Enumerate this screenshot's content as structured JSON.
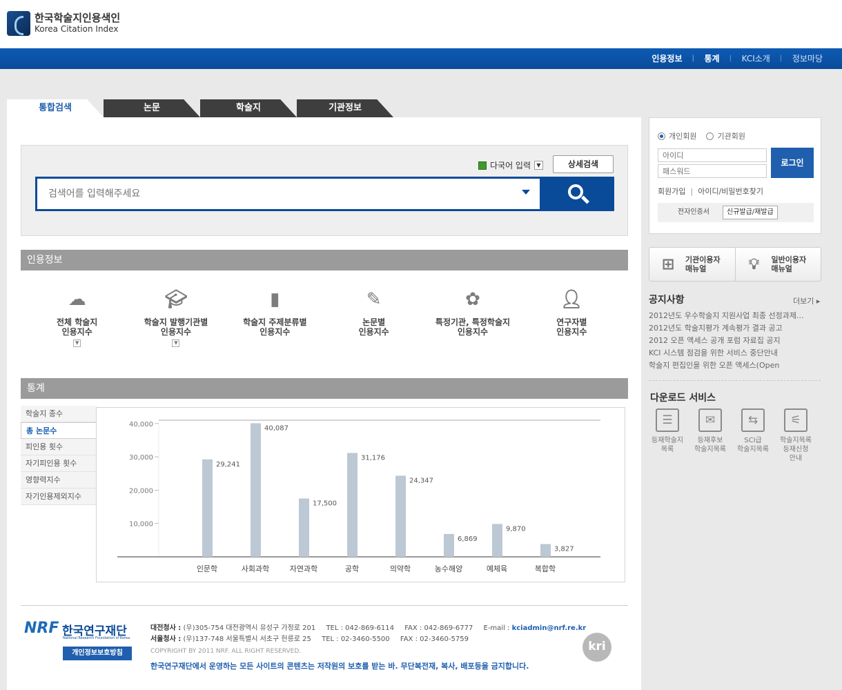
{
  "brand": {
    "name_ko": "한국학술지인용색인",
    "name_en": "Korea Citation Index"
  },
  "gnb": [
    "인용정보",
    "통계",
    "KCI소개",
    "정보마당"
  ],
  "tabs": [
    "통합검색",
    "논문",
    "학술지",
    "기관정보"
  ],
  "search": {
    "multilang_label": "다국어 입력",
    "advanced_label": "상세검색",
    "placeholder": "검색어를 입력해주세요"
  },
  "citation": {
    "title": "인용정보",
    "items": [
      {
        "l1": "전체 학술지",
        "l2": "인용지수",
        "icon": "cloud-icon"
      },
      {
        "l1": "학술지 발행기관별",
        "l2": "인용지수",
        "icon": "graduation-cap-icon"
      },
      {
        "l1": "학술지 주제분류별",
        "l2": "인용지수",
        "icon": "book-icon"
      },
      {
        "l1": "논문별",
        "l2": "인용지수",
        "icon": "pen-icon"
      },
      {
        "l1": "특정기관, 특정학술지",
        "l2": "인용지수",
        "icon": "flower-icon"
      },
      {
        "l1": "연구자별",
        "l2": "인용지수",
        "icon": "person-icon"
      }
    ]
  },
  "stats": {
    "title": "통계",
    "menu": [
      "학술지 종수",
      "총 논문수",
      "피인용 횟수",
      "자기피인용 횟수",
      "영향력지수",
      "자기인용제외지수"
    ],
    "active_index": 1
  },
  "chart_data": {
    "type": "bar",
    "categories": [
      "인문학",
      "사회과학",
      "자연과학",
      "공학",
      "의약학",
      "농수해양",
      "예체육",
      "복합학"
    ],
    "values": [
      29241,
      40087,
      17500,
      31176,
      24347,
      6869,
      9870,
      3827
    ],
    "value_labels": [
      "29,241",
      "40,087",
      "17,500",
      "31,176",
      "24,347",
      "6,869",
      "9,870",
      "3,827"
    ],
    "yticks": [
      10000,
      20000,
      30000,
      40000
    ],
    "ytick_labels": [
      "10,000",
      "20,000",
      "30,000",
      "40,000"
    ],
    "ylim": [
      0,
      41000
    ],
    "bar_color": "#bcc8d4",
    "grid": false
  },
  "login": {
    "member_personal": "개인회원",
    "member_org": "기관회원",
    "id_placeholder": "아이디",
    "pw_placeholder": "패스워드",
    "login_btn": "로그인",
    "join": "회원가입",
    "find": "아이디/비밀번호찾기",
    "cert_label": "전자인증서",
    "cert_btn": "신규발급/재발급"
  },
  "manuals": [
    {
      "l1": "기관이용자",
      "l2": "매뉴얼",
      "icon": "org-chart-icon"
    },
    {
      "l1": "일반이용자",
      "l2": "매뉴얼",
      "icon": "lightbulb-icon"
    }
  ],
  "notice": {
    "title": "공지사항",
    "more": "더보기",
    "items": [
      "2012년도 우수학술지 지원사업 최종 선정과제...",
      "2012년도 학술지평가 계속평가 결과 공고",
      "2012 오픈 액세스 공개 포럼 자료집 공지",
      "KCI 시스템 점검을 위한 서비스 중단안내",
      "학술지 편집인을 위한 오픈 액세스(Open"
    ]
  },
  "download": {
    "title": "다운로드 서비스",
    "items": [
      {
        "l1": "등재학술지",
        "l2": "목록",
        "l3": "",
        "icon": "list-document-icon"
      },
      {
        "l1": "등재후보",
        "l2": "학술지목록",
        "l3": "",
        "icon": "envelope-icon"
      },
      {
        "l1": "SCI급",
        "l2": "학술지목록",
        "l3": "",
        "icon": "signpost-icon"
      },
      {
        "l1": "학술지목록",
        "l2": "등재신청",
        "l3": "안내",
        "icon": "satellite-icon"
      }
    ]
  },
  "footer": {
    "org_mark": "NRF",
    "org_ko": "한국연구재단",
    "org_en": "National Research Foundation of Korea",
    "privacy_btn": "개인정보보호방침",
    "daejeon_label": "대전청사 :",
    "daejeon_addr": "(우)305-754 대전광역시 유성구 가정로 201",
    "daejeon_tel": "TEL : 042-869-6114",
    "daejeon_fax": "FAX : 042-869-6777",
    "email_label": "E-mail :",
    "email": "kciadmin@nrf.re.kr",
    "seoul_label": "서울청사 :",
    "seoul_addr": "(우)137-748 서울특별시 서초구 헌릉로 25",
    "seoul_tel": "TEL : 02-3460-5500",
    "seoul_fax": "FAX : 02-3460-5759",
    "copyright": "COPYRIGHT BY 2011 NRF. ALL RIGHT RESERVED.",
    "notice": "한국연구재단에서 운영하는 모든 사이트의 콘텐츠는 저작원의 보호를 받는 바. 무단복전재, 복사, 배포등을 금지합니다.",
    "kri": "kri"
  }
}
